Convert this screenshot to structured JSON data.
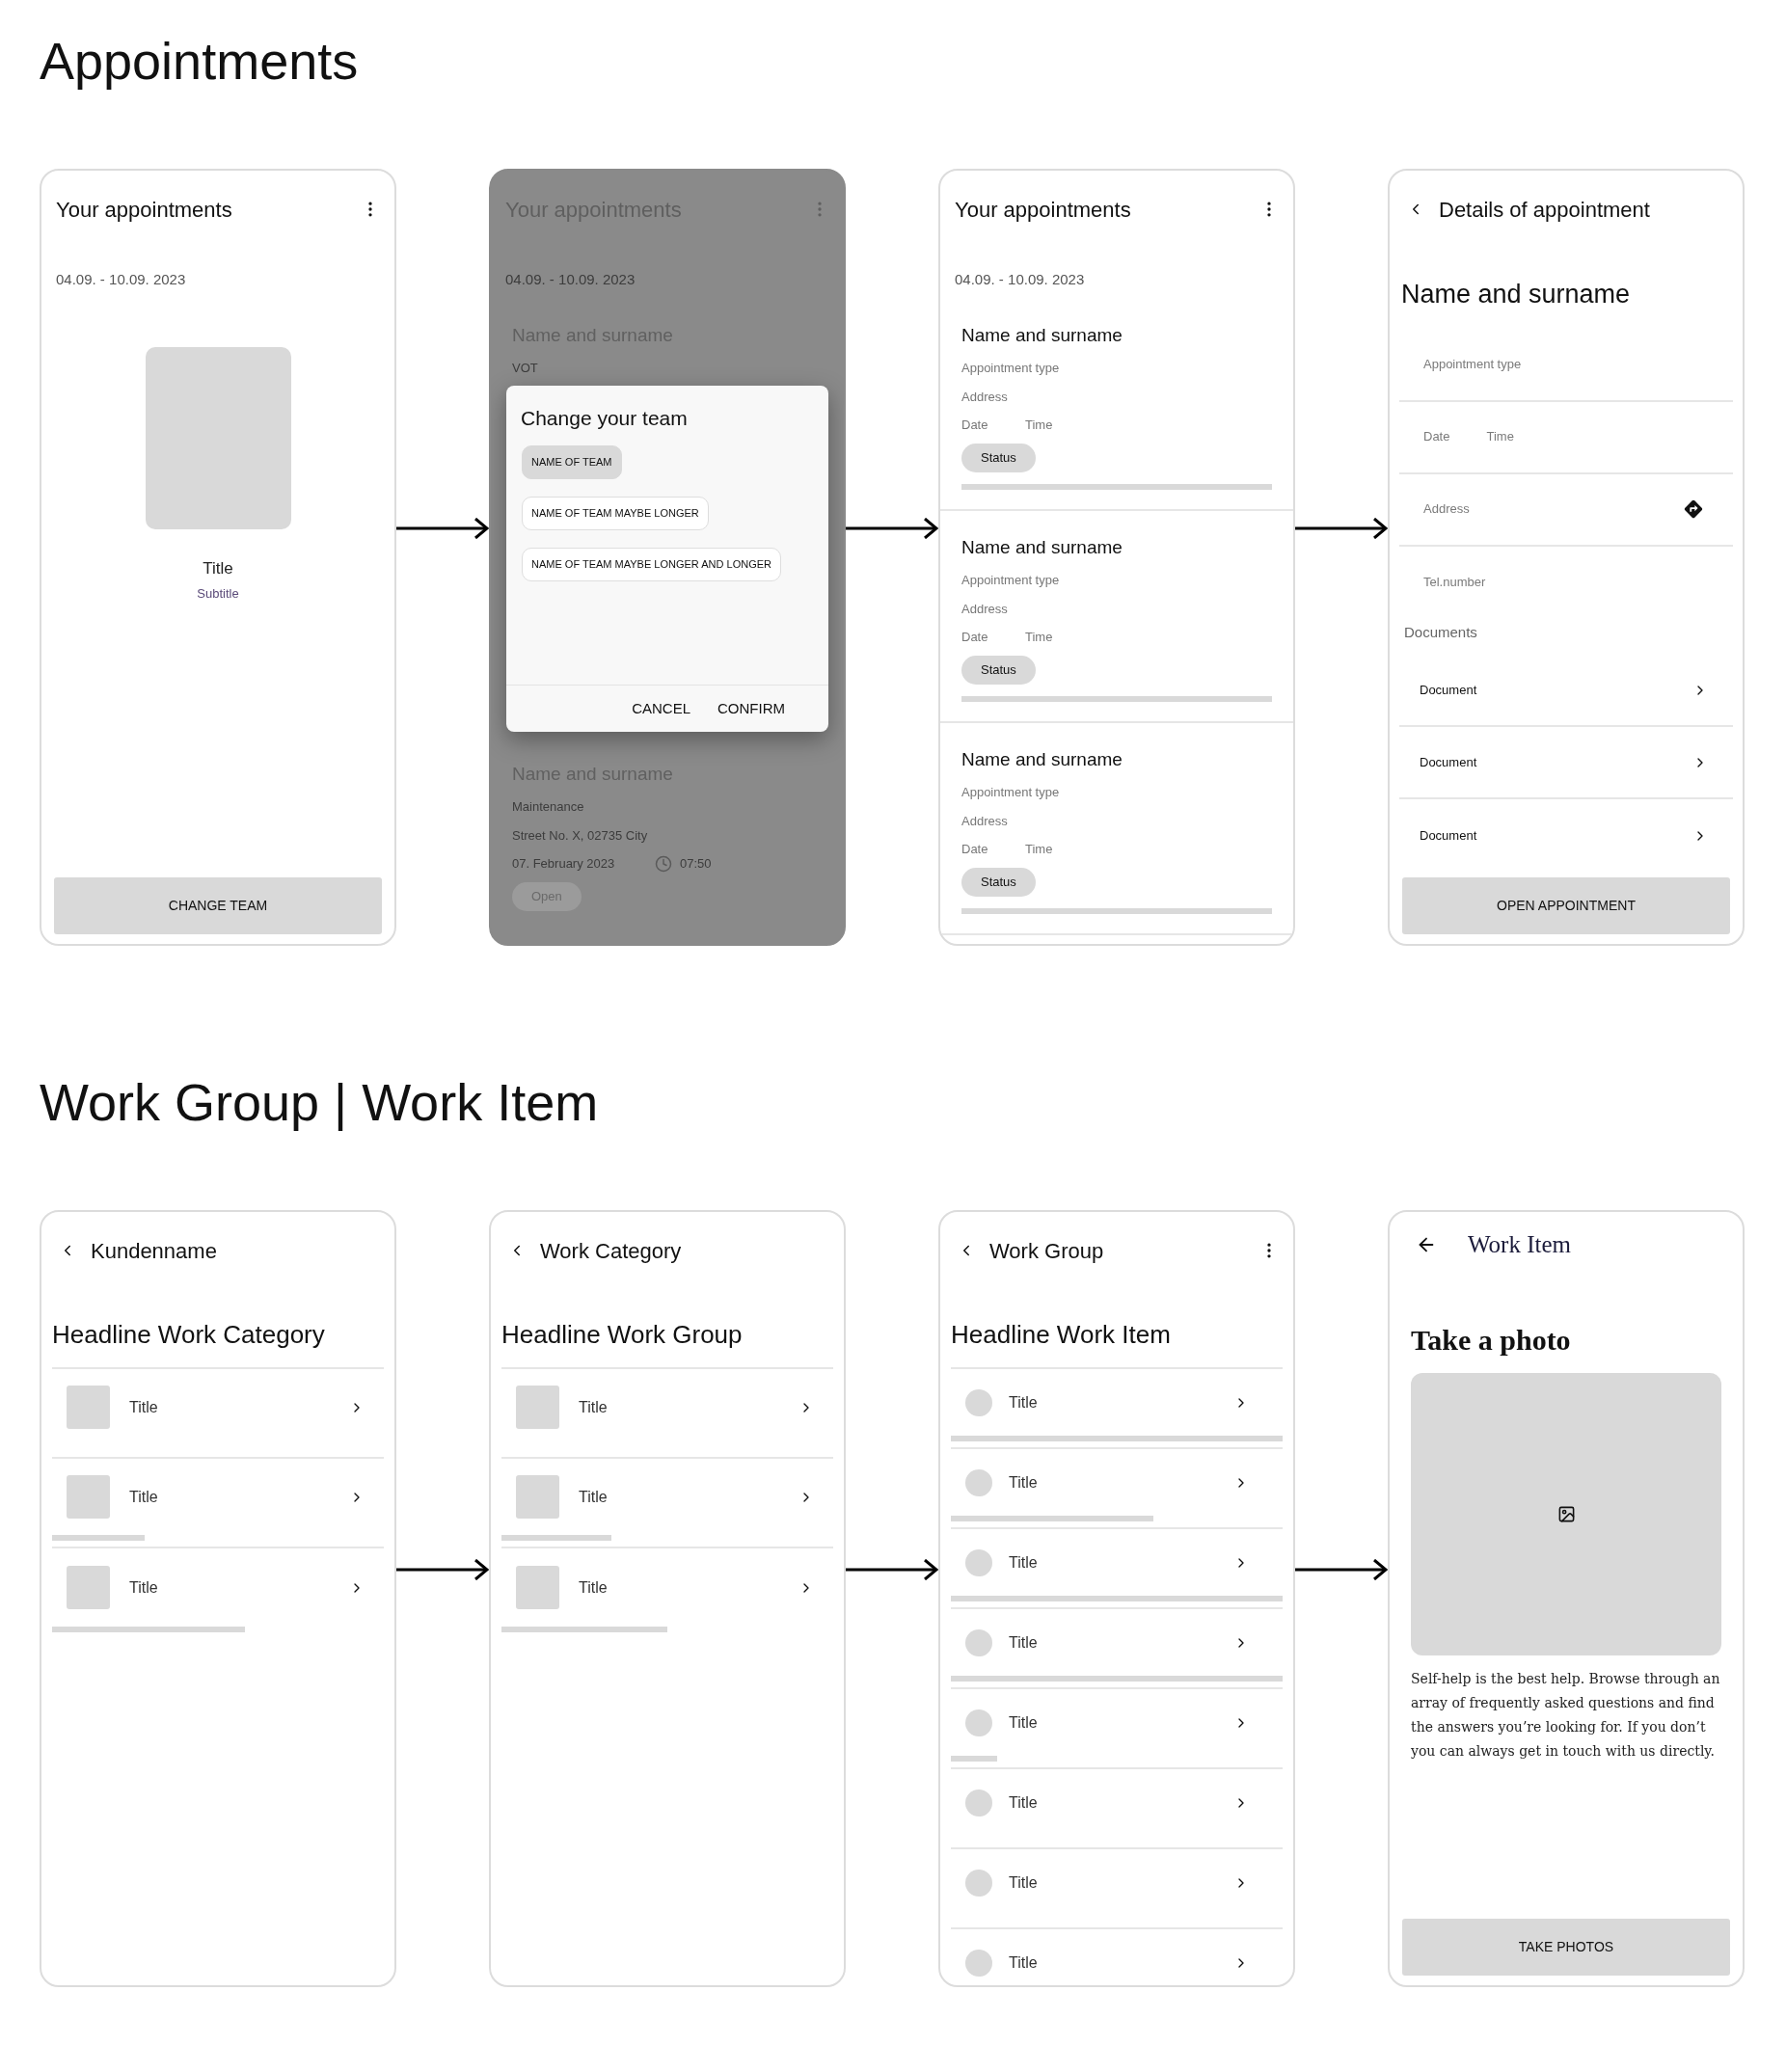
{
  "sections": [
    {
      "title": "Appointments",
      "screens": [
        {
          "kind": "empty",
          "header": {
            "title": "Your appointments",
            "back": false,
            "menu": true
          },
          "date_range": "04.09. - 10.09. 2023",
          "empty_state": {
            "title": "Title",
            "subtitle": "Subtitle"
          },
          "button": "CHANGE TEAM"
        },
        {
          "kind": "dialog",
          "header": {
            "title": "Your appointments",
            "back": false,
            "menu": true
          },
          "date_range": "04.09. - 10.09. 2023",
          "appointments": [
            {
              "name": "Name and surname",
              "type": "VOT"
            },
            {
              "name": "Name and surname",
              "type": "Maintenance",
              "address": "Street No. X, 02735 City",
              "date": "07. February 2023",
              "time": "07:50",
              "status": "Open"
            }
          ],
          "dialog": {
            "title": "Change your team",
            "options": [
              {
                "label": "NAME OF TEAM",
                "selected": true
              },
              {
                "label": "NAME OF TEAM MAYBE LONGER",
                "selected": false
              },
              {
                "label": "NAME OF TEAM MAYBE LONGER AND LONGER",
                "selected": false
              }
            ],
            "actions": [
              "CANCEL",
              "CONFIRM"
            ]
          }
        },
        {
          "kind": "list",
          "header": {
            "title": "Your appointments",
            "back": false,
            "menu": true
          },
          "date_range": "04.09. - 10.09. 2023",
          "appointments": [
            {
              "name": "Name and surname",
              "type": "Appointment type",
              "address": "Address",
              "date": "Date",
              "time": "Time",
              "status": "Status"
            },
            {
              "name": "Name and surname",
              "type": "Appointment type",
              "address": "Address",
              "date": "Date",
              "time": "Time",
              "status": "Status"
            },
            {
              "name": "Name and surname",
              "type": "Appointment type",
              "address": "Address",
              "date": "Date",
              "time": "Time",
              "status": "Status"
            }
          ]
        },
        {
          "kind": "details",
          "header": {
            "title": "Details of appointment",
            "back": true,
            "menu": false
          },
          "name": "Name and surname",
          "fields": [
            {
              "texts": [
                "Appointment type"
              ],
              "directions": false
            },
            {
              "texts": [
                "Date",
                "Time"
              ],
              "directions": false
            },
            {
              "texts": [
                "Address"
              ],
              "directions": true
            },
            {
              "texts": [
                "Tel.number"
              ],
              "directions": false
            }
          ],
          "documents_label": "Documents",
          "documents": [
            "Document",
            "Document",
            "Document"
          ],
          "button": "OPEN APPOINTMENT"
        }
      ]
    },
    {
      "title": "Work Group | Work Item",
      "screens": [
        {
          "kind": "tiles",
          "header": {
            "title": "Kundenname",
            "back": true,
            "menu": false
          },
          "headline": "Headline Work Category",
          "items": [
            {
              "title": "Title"
            },
            {
              "title": "Title",
              "level": 0.28
            },
            {
              "title": "Title",
              "level": 0.58
            }
          ]
        },
        {
          "kind": "tiles",
          "header": {
            "title": "Work Category",
            "back": true,
            "menu": false
          },
          "headline": "Headline Work Group",
          "items": [
            {
              "title": "Title"
            },
            {
              "title": "Title",
              "level": 0.33
            },
            {
              "title": "Title",
              "level": 0.5
            }
          ]
        },
        {
          "kind": "circles",
          "header": {
            "title": "Work Group",
            "back": true,
            "menu": true
          },
          "headline": "Headline Work Item",
          "items": [
            {
              "title": "Title",
              "level": 1
            },
            {
              "title": "Title",
              "level": 0.61
            },
            {
              "title": "Title",
              "level": 1
            },
            {
              "title": "Title",
              "level": 1
            },
            {
              "title": "Title",
              "level": 0.14
            },
            {
              "title": "Title"
            },
            {
              "title": "Title"
            },
            {
              "title": "Title"
            }
          ]
        },
        {
          "kind": "photo",
          "header": {
            "title": "Work Item",
            "back": true,
            "menu": false
          },
          "headline": "Take a photo",
          "text": "Self-help is the best help. Browse through an array of frequently asked questions and find the answers you’re looking for. If you don’t you can always get in touch with us directly.",
          "button": "TAKE PHOTOS"
        }
      ]
    }
  ]
}
